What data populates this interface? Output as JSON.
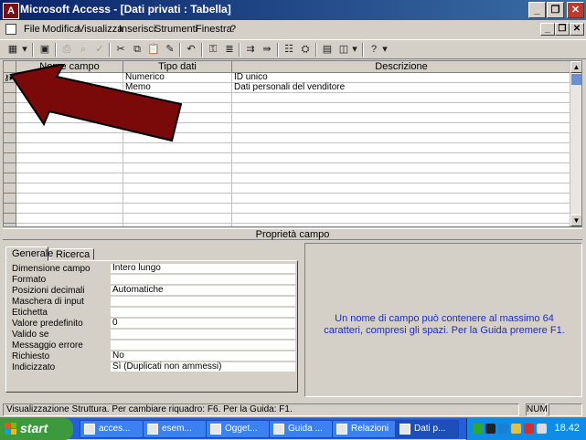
{
  "window": {
    "title": "Microsoft Access - [Dati privati : Tabella]"
  },
  "menu": [
    {
      "label": "File"
    },
    {
      "label": "Modifica"
    },
    {
      "label": "Visualizza"
    },
    {
      "label": "Inserisci"
    },
    {
      "label": "Strumenti"
    },
    {
      "label": "Finestra"
    },
    {
      "label": "?"
    }
  ],
  "grid": {
    "columns": [
      "Nome campo",
      "Tipo dati",
      "Descrizione"
    ],
    "rows": [
      {
        "field": "ID",
        "type": "Numerico",
        "description": "ID unico"
      },
      {
        "field": "Dati",
        "type": "Memo",
        "description": "Dati personali del venditore"
      }
    ]
  },
  "properties": {
    "header": "Proprietà campo",
    "tabs": [
      {
        "label": "Generale"
      },
      {
        "label": "Ricerca"
      }
    ],
    "rows": [
      {
        "label": "Dimensione campo",
        "value": "Intero lungo"
      },
      {
        "label": "Formato",
        "value": ""
      },
      {
        "label": "Posizioni decimali",
        "value": "Automatiche"
      },
      {
        "label": "Maschera di input",
        "value": ""
      },
      {
        "label": "Etichetta",
        "value": ""
      },
      {
        "label": "Valore predefinito",
        "value": "0"
      },
      {
        "label": "Valido se",
        "value": ""
      },
      {
        "label": "Messaggio errore",
        "value": ""
      },
      {
        "label": "Richiesto",
        "value": "No"
      },
      {
        "label": "Indicizzato",
        "value": "Sì (Duplicati non ammessi)"
      }
    ],
    "help": "Un nome di campo può contenere al massimo 64 caratteri, compresi gli spazi. Per la Guida premere F1."
  },
  "status": {
    "text": "Visualizzazione Struttura. Per cambiare riquadro: F6. Per la Guida: F1.",
    "num": "NUM"
  },
  "taskbar": {
    "start": "start",
    "tasks": [
      {
        "label": "acces..."
      },
      {
        "label": "esem..."
      },
      {
        "label": "Ogget..."
      },
      {
        "label": "Guida ..."
      },
      {
        "label": "Relazioni"
      },
      {
        "label": "Dati p..."
      }
    ],
    "clock": "18.42"
  },
  "colors": {
    "titlebar": "#0a246a",
    "arrow": "#7a0a0a",
    "help_text": "#1c2cc8",
    "taskbar": "#245edb",
    "start": "#3c9a3c"
  }
}
